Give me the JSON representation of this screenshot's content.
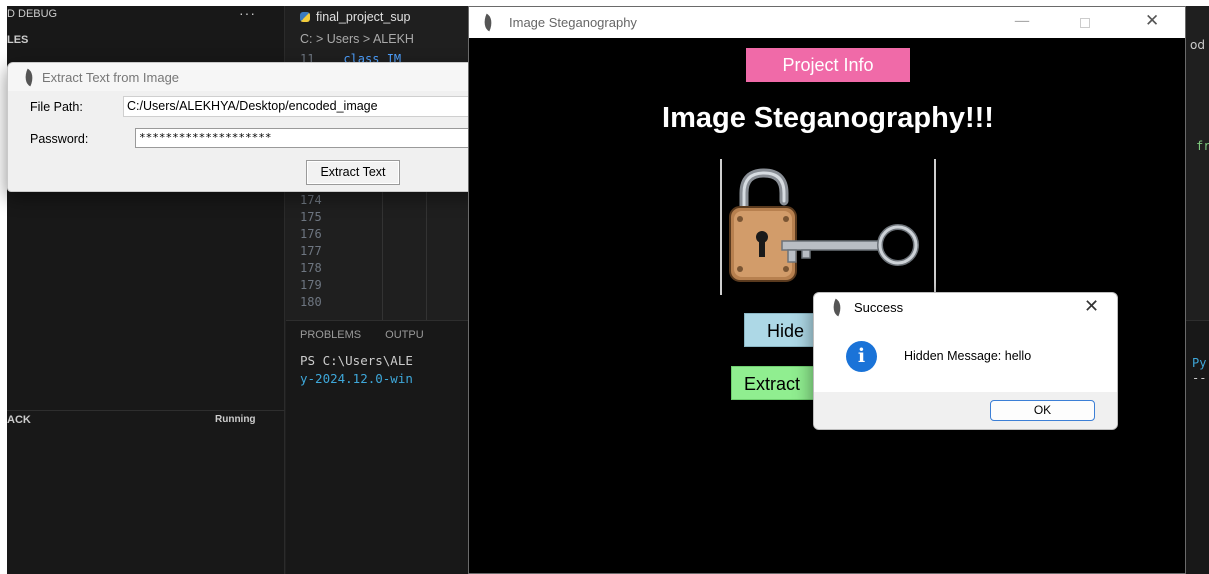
{
  "vscode": {
    "side_title": "D DEBUG",
    "side_dots": "···",
    "side_files": "LES",
    "side_stack": "ACK",
    "side_running": "Running",
    "editor_tab": "final_project_sup",
    "breadcrumb": "C: > Users > ALEKH",
    "class_line_number": "11",
    "class_line_code": "class IM",
    "gutter_lines": [
      "174",
      "175",
      "176",
      "177",
      "178",
      "179",
      "180"
    ],
    "panel_tabs": [
      "PROBLEMS",
      "OUTPU"
    ],
    "terminal_line_1": "PS C:\\Users\\ALE",
    "terminal_line_2": "y-2024.12.0-win",
    "right_edge_od": "od",
    "right_edge_fr": "fr",
    "right_edge_py": "Py",
    "right_edge_dash": "--"
  },
  "extract_dialog": {
    "title": "Extract Text from Image",
    "file_path_label": "File Path:",
    "file_path_value": "C:/Users/ALEKHYA/Desktop/encoded_image",
    "password_label": "Password:",
    "password_value": "********************",
    "extract_button": "Extract Text"
  },
  "steg_window": {
    "title": "Image Steganography",
    "minimize": "—",
    "close": "✕",
    "project_info_button": "Project Info",
    "heading": "Image Steganography!!!",
    "hide_button": "Hide",
    "extract_button": "Extract"
  },
  "success_dialog": {
    "title": "Success",
    "close": "✕",
    "info_glyph": "i",
    "message": "Hidden Message: hello",
    "ok_button": "OK"
  },
  "colors": {
    "project_info_bg": "#f06aa8",
    "hide_bg": "#add8e6",
    "extract_bg": "#90ee90",
    "info_icon": "#1a73d8"
  }
}
